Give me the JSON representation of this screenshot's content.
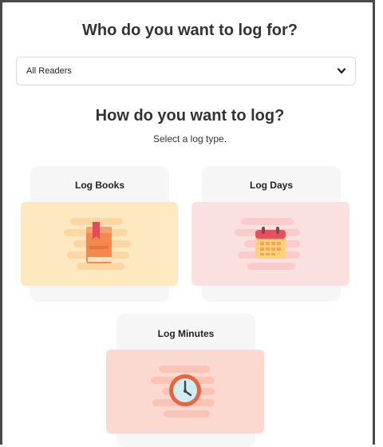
{
  "header": {
    "title": "Who do you want to log for?"
  },
  "reader_select": {
    "value": "All Readers"
  },
  "log_section": {
    "title": "How do you want to log?",
    "subtitle": "Select a log type."
  },
  "options": [
    {
      "label": "Log Books",
      "icon": "book-icon",
      "bg": "#fde8c0"
    },
    {
      "label": "Log Days",
      "icon": "calendar-icon",
      "bg": "#fbe0e0"
    },
    {
      "label": "Log Minutes",
      "icon": "clock-icon",
      "bg": "#fcd9d0"
    }
  ]
}
